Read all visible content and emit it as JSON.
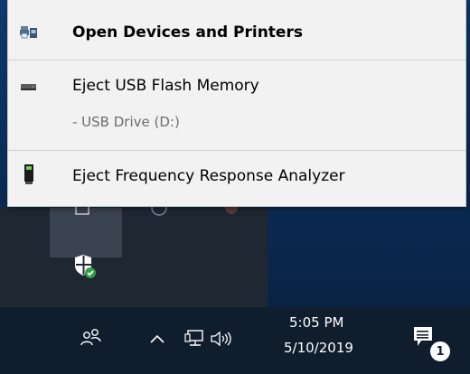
{
  "context_menu": {
    "items": [
      {
        "label": "Open Devices and Printers",
        "icon": "devices-printers-icon",
        "bold": true
      },
      {
        "label": "Eject USB Flash Memory",
        "icon": "usb-drive-icon",
        "sublabel": "- USB Drive (D:)"
      },
      {
        "label": "Eject Frequency Response Analyzer",
        "icon": "usb-device-icon"
      }
    ]
  },
  "taskbar": {
    "time": "5:05 PM",
    "date": "5/10/2019",
    "notification_count": "1",
    "icons": [
      "people-icon",
      "show-hidden-icons-chevron",
      "network-icon",
      "volume-icon",
      "action-center-icon"
    ]
  },
  "tray_overflow": {
    "icons": [
      "windows-security-icon"
    ]
  },
  "colors": {
    "menu_bg": "#f2f2f2",
    "taskbar_bg": "#101d2d",
    "security_green": "#2ea043"
  }
}
